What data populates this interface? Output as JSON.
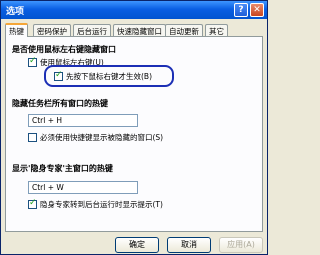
{
  "window": {
    "title": "选项",
    "help_glyph": "?",
    "close_glyph": "✕"
  },
  "tabs": [
    {
      "label": "热键",
      "active": true
    },
    {
      "label": "密码保护",
      "active": false
    },
    {
      "label": "后台运行",
      "active": false
    },
    {
      "label": "快速隐藏窗口",
      "active": false
    },
    {
      "label": "自动更新",
      "active": false
    },
    {
      "label": "其它",
      "active": false
    }
  ],
  "section_mouse": {
    "heading": "是否使用鼠标左右键隐藏窗口",
    "use_mouse_label": "使用鼠标左右键(U)",
    "use_mouse_checked": true,
    "right_first_label": "先按下鼠标右键才生效(B)",
    "right_first_checked": true
  },
  "section_taskbar": {
    "heading": "隐藏任务栏所有窗口的热键",
    "hotkey_value": "Ctrl + H",
    "show_hidden_label": "必须使用快捷键显示被隐藏的窗口(S)",
    "show_hidden_checked": false
  },
  "section_main": {
    "heading": "显示'隐身专家'主窗口的热键",
    "hotkey_value": "Ctrl + W",
    "tip_label": "隐身专家转到后台运行时显示提示(T)",
    "tip_checked": true
  },
  "buttons": {
    "ok": "确定",
    "cancel": "取消",
    "apply": "应用(A)"
  }
}
